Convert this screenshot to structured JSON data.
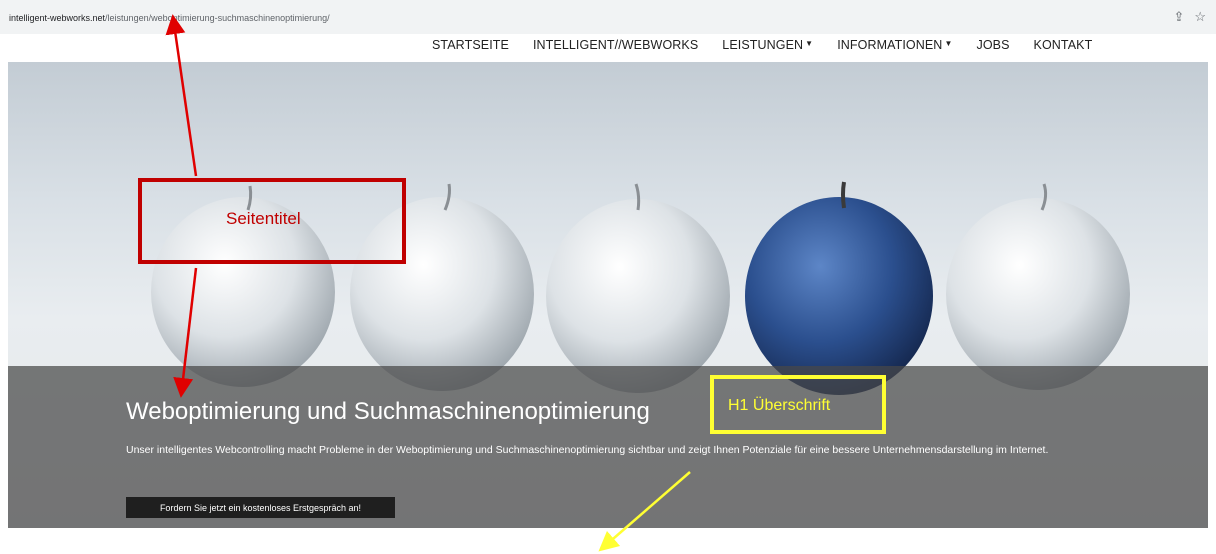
{
  "browser": {
    "url_host": "intelligent-webworks.net",
    "url_path": "/leistungen/weboptimierung-suchmaschinenoptimierung/",
    "share_icon": "share-icon",
    "star_icon": "bookmark-star-icon"
  },
  "nav": {
    "items": [
      {
        "label": "STARTSEITE",
        "dropdown": false
      },
      {
        "label": "INTELLIGENT//WEBWORKS",
        "dropdown": false
      },
      {
        "label": "LEISTUNGEN",
        "dropdown": true
      },
      {
        "label": "INFORMATIONEN",
        "dropdown": true
      },
      {
        "label": "JOBS",
        "dropdown": false
      },
      {
        "label": "KONTAKT",
        "dropdown": false
      }
    ]
  },
  "hero": {
    "heading": "Weboptimierung und Suchmaschinenoptimierung",
    "lead": "Unser intelligentes Webcontrolling macht Probleme in der Weboptimierung und Suchmaschinenoptimierung sichtbar und zeigt Ihnen Potenziale für eine bessere Unternehmensdarstellung im Internet.",
    "cta_label": "Fordern Sie jetzt ein kostenloses Erstgespräch an!"
  },
  "annotations": {
    "red_label": "Seitentitel",
    "yellow_label": "H1 Überschrift",
    "red_color": "#c00000",
    "yellow_color": "#ffff33"
  }
}
